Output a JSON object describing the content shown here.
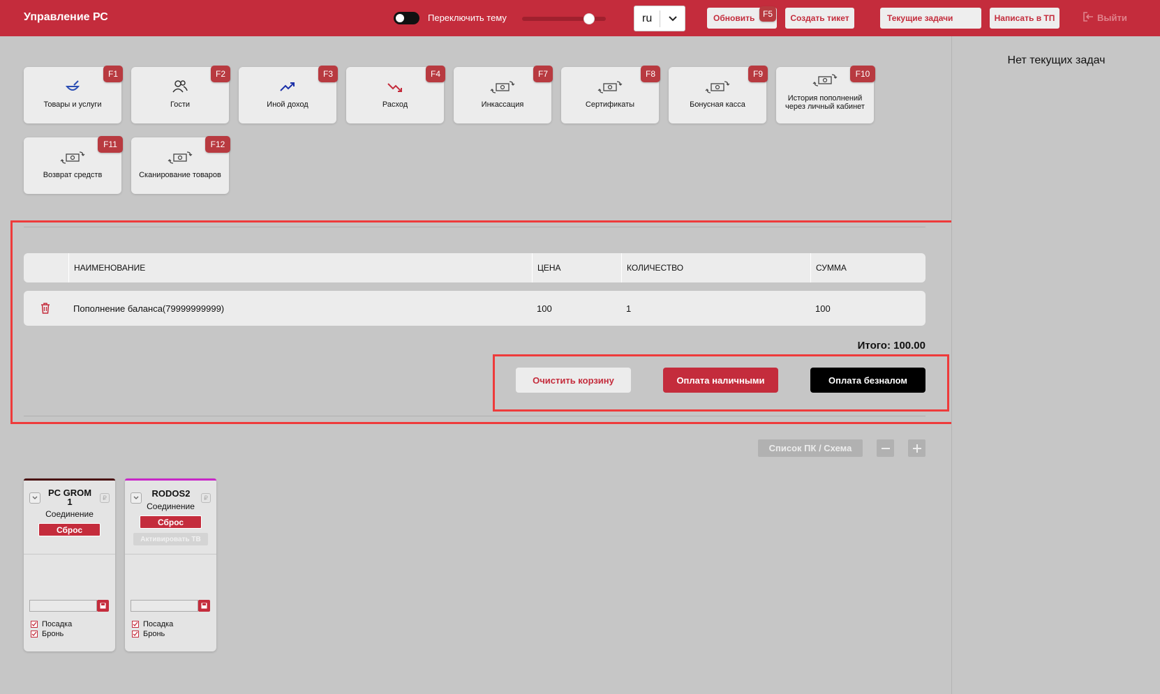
{
  "header": {
    "title": "Управление РС",
    "theme_label": "Переключить тему",
    "lang": "ru",
    "refresh_label": "Обновить",
    "refresh_key": "F5",
    "create_ticket_label": "Создать тикет",
    "current_tasks_label": "Текущие задачи",
    "write_support_label": "Написать в ТП",
    "logout_label": "Выйти"
  },
  "tiles": [
    {
      "label": "Товары и услуги",
      "key": "F1",
      "icon": "bowl-icon"
    },
    {
      "label": "Гости",
      "key": "F2",
      "icon": "users-icon"
    },
    {
      "label": "Иной доход",
      "key": "F3",
      "icon": "trend-up-icon"
    },
    {
      "label": "Расход",
      "key": "F4",
      "icon": "trend-down-icon"
    },
    {
      "label": "Инкассация",
      "key": "F7",
      "icon": "money-exchange-icon"
    },
    {
      "label": "Сертификаты",
      "key": "F8",
      "icon": "money-exchange-icon"
    },
    {
      "label": "Бонусная касса",
      "key": "F9",
      "icon": "money-exchange-icon"
    },
    {
      "label": "История пополнений через личный кабинет",
      "key": "F10",
      "icon": "money-exchange-icon"
    },
    {
      "label": "Возврат средств",
      "key": "F11",
      "icon": "money-exchange-icon"
    },
    {
      "label": "Сканирование товаров",
      "key": "F12",
      "icon": "money-exchange-icon"
    }
  ],
  "cart": {
    "columns": {
      "name": "НАИМЕНОВАНИЕ",
      "price": "ЦЕНА",
      "qty": "КОЛИЧЕСТВО",
      "sum": "СУММА"
    },
    "rows": [
      {
        "name": "Пополнение баланса(79999999999)",
        "price": "100",
        "qty": "1",
        "sum": "100"
      }
    ],
    "total": "Итого: 100.00",
    "clear_label": "Очистить корзину",
    "cash_label": "Оплата наличными",
    "card_label": "Оплата безналом"
  },
  "pc_controls": {
    "list_label": "Список ПК / Схема"
  },
  "pcs": [
    {
      "name": "PC GROM 1",
      "status": "Соединение",
      "reset_label": "Сброс",
      "activate_label": "",
      "check1": "Посадка",
      "check2": "Бронь",
      "accent": "#4a1212",
      "ruble": "₽"
    },
    {
      "name": "RODOS2",
      "status": "Соединение",
      "reset_label": "Сброс",
      "activate_label": "Активировать ТВ",
      "check1": "Посадка",
      "check2": "Бронь",
      "accent": "#c827c8",
      "ruble": "₽"
    }
  ],
  "right_panel": {
    "empty_text": "Нет текущих задач"
  },
  "colors": {
    "brand": "#c42c3c",
    "fkey": "#b83a40",
    "highlight": "#ee3b3b"
  }
}
